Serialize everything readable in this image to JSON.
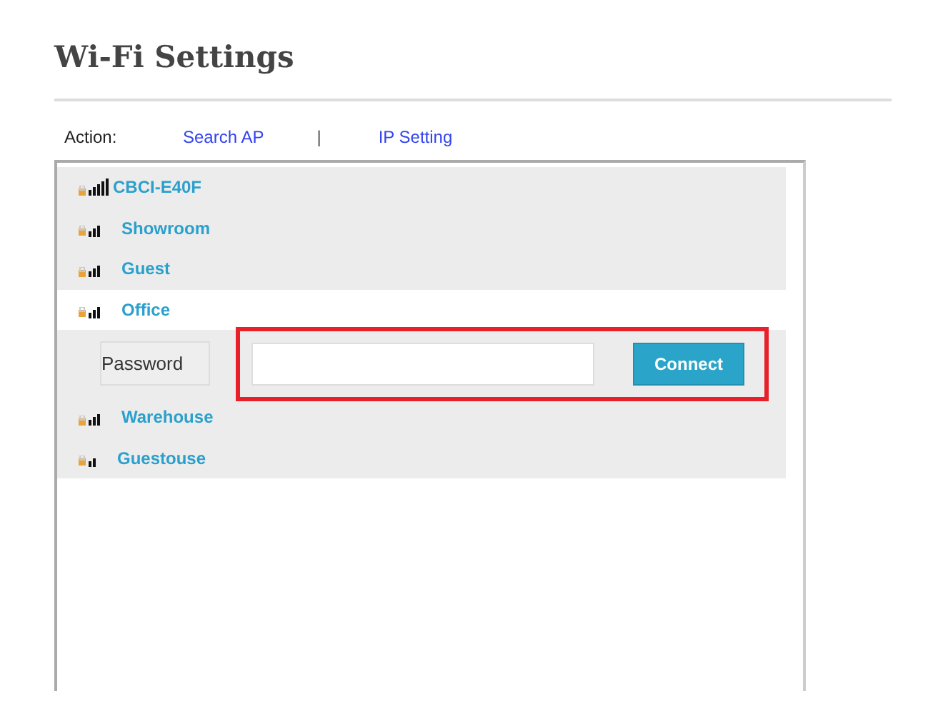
{
  "page": {
    "title": "Wi-Fi Settings"
  },
  "actions": {
    "label": "Action:",
    "links": [
      "Search AP",
      "IP Setting"
    ],
    "separator": "|"
  },
  "networks": [
    {
      "name": "CBCI-E40F",
      "kind": "strong",
      "selected": false
    },
    {
      "name": "Showroom",
      "kind": "medium",
      "selected": false
    },
    {
      "name": "Guest",
      "kind": "medium",
      "selected": false
    },
    {
      "name": "Office",
      "kind": "medium",
      "selected": true
    },
    {
      "name": "Warehouse",
      "kind": "medium",
      "selected": false
    },
    {
      "name": "Guestouse",
      "kind": "weak",
      "selected": false
    }
  ],
  "password_form": {
    "label": "Password",
    "button": "Connect",
    "highlighted": true
  }
}
